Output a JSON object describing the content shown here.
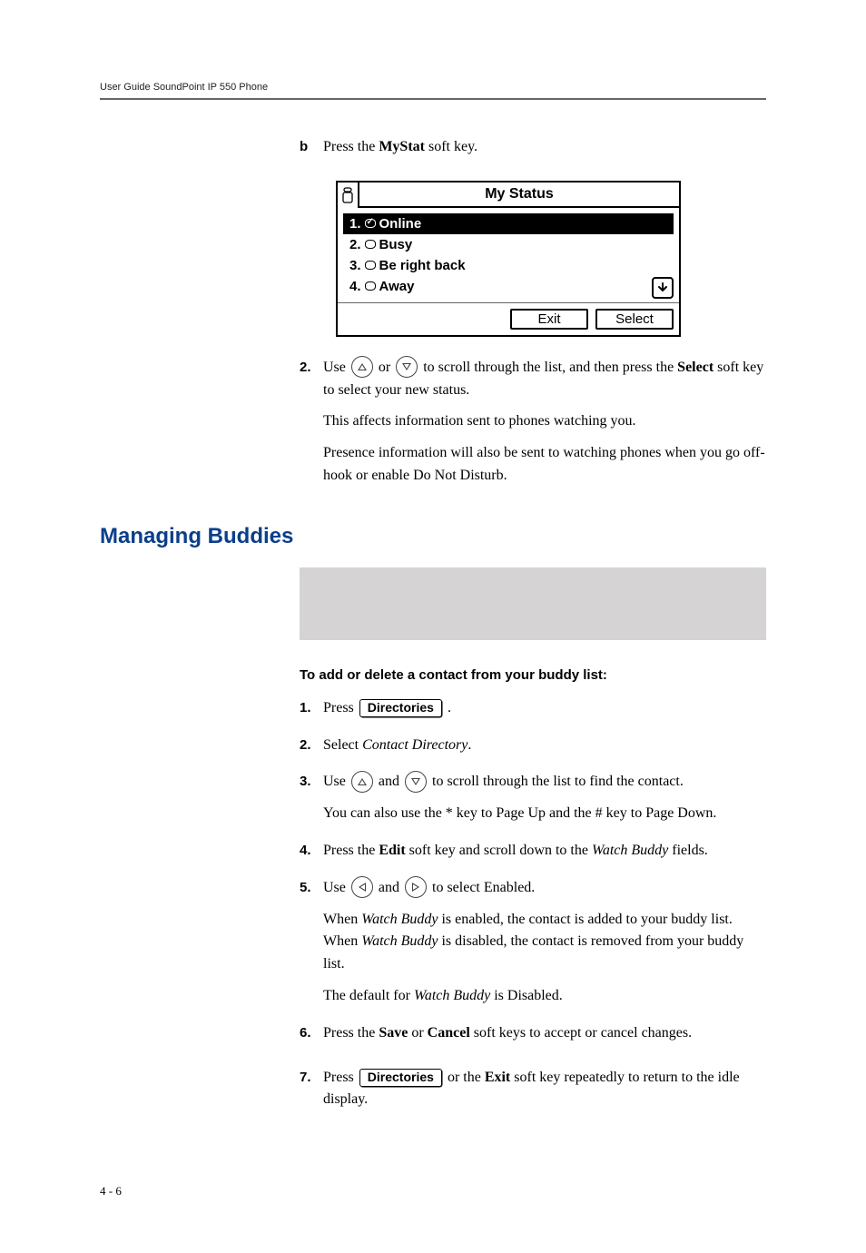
{
  "header": "User Guide SoundPoint IP 550 Phone",
  "step_b": {
    "letter": "b",
    "text_pre": "Press the ",
    "bold": "MyStat",
    "text_post": " soft key."
  },
  "screen": {
    "title": "My Status",
    "items": [
      {
        "num": "1.",
        "label": "Online",
        "selected": true,
        "checked": true
      },
      {
        "num": "2.",
        "label": "Busy",
        "selected": false,
        "checked": false
      },
      {
        "num": "3.",
        "label": "Be right back",
        "selected": false,
        "checked": false
      },
      {
        "num": "4.",
        "label": "Away",
        "selected": false,
        "checked": false
      }
    ],
    "softkeys": {
      "exit": "Exit",
      "select": "Select"
    }
  },
  "step2": {
    "num": "2.",
    "p1a": "Use ",
    "p1b": " or ",
    "p1c": " to scroll through the list, and then press the ",
    "p1bold": "Select",
    "p1d": " soft key to select your new status.",
    "p2": "This affects information sent to phones watching you.",
    "p3": "Presence information will also be sent to watching phones when you go off-hook or enable Do Not Disturb."
  },
  "section_title": "Managing Buddies",
  "subheading": "To add or delete a contact from your buddy list:",
  "s1": {
    "num": "1.",
    "a": "Press ",
    "key": "Directories",
    "b": " ."
  },
  "s2": {
    "num": "2.",
    "a": "Select ",
    "it": "Contact Directory",
    "b": "."
  },
  "s3": {
    "num": "3.",
    "a": "Use ",
    "b": " and ",
    "c": " to scroll through the list to find the contact.",
    "p2": "You can also use the * key to Page Up and the # key to Page Down."
  },
  "s4": {
    "num": "4.",
    "a": "Press the ",
    "bold": "Edit",
    "b": " soft key and scroll down to the ",
    "it": "Watch Buddy",
    "c": " fields."
  },
  "s5": {
    "num": "5.",
    "a": "Use ",
    "b": " and ",
    "c": " to select Enabled.",
    "p2a": "When ",
    "p2it1": "Watch Buddy",
    "p2b": " is enabled, the contact is added to your buddy list. When ",
    "p2it2": "Watch Buddy",
    "p2c": " is disabled, the contact is removed from your buddy list.",
    "p3a": "The default for ",
    "p3it": "Watch Buddy",
    "p3b": " is Disabled."
  },
  "s6": {
    "num": "6.",
    "a": "Press the ",
    "b1": "Save",
    "b": " or ",
    "b2": "Cancel",
    "c": " soft keys to accept or cancel changes."
  },
  "s7": {
    "num": "7.",
    "a": "Press ",
    "key": "Directories",
    "b": " or the ",
    "bold": "Exit",
    "c": " soft key repeatedly to return to the idle display."
  },
  "footer": "4 - 6"
}
